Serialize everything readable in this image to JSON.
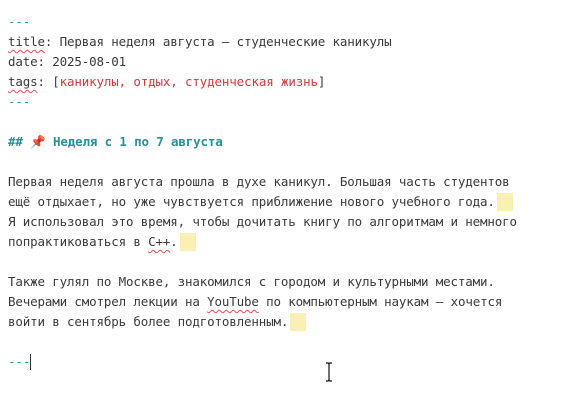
{
  "document": {
    "frontmatter_open": "---",
    "title_key": "title",
    "title_value": "Первая неделя августа — студенческие каникулы",
    "date_key": "date",
    "date_value": "2025-08-01",
    "tags_key": "tags",
    "tags_open": "[",
    "tags_value": "каникулы, отдых, студенческая жизнь",
    "tags_close": "]",
    "frontmatter_close": "---",
    "heading_marker": "##",
    "heading_emoji": "📌",
    "heading_text": "Неделя с 1 по 7 августа",
    "para1_line1": "Первая неделя августа прошла в духе каникул. Большая часть студентов",
    "para1_line2": "ещё отдыхает, но уже чувствуется приближение нового учебного года.",
    "para1_line3": "Я использовал это время, чтобы дочитать книгу по алгоритмам и немного",
    "para1_line4_a": "попрактиковаться в ",
    "para1_line4_word": "C++",
    "para1_line4_b": ".",
    "para2_line1": "Также гулял по Москве, знакомился с городом и культурными местами.",
    "para2_line2_a": "Вечерами смотрел лекции на ",
    "para2_line2_word": "YouTube",
    "para2_line2_b": " по компьютерным наукам — хочется",
    "para2_line3": "войти в сентябрь более подготовленным.",
    "hr": "---"
  },
  "colors": {
    "frontmatter": "#2a9aa8",
    "heading": "#2a8f99",
    "tags": "#d13a3a",
    "text": "#3a3a3a",
    "trailing_space_highlight": "#fbf0b4"
  },
  "cursor_icon": "text-ibeam-cursor"
}
